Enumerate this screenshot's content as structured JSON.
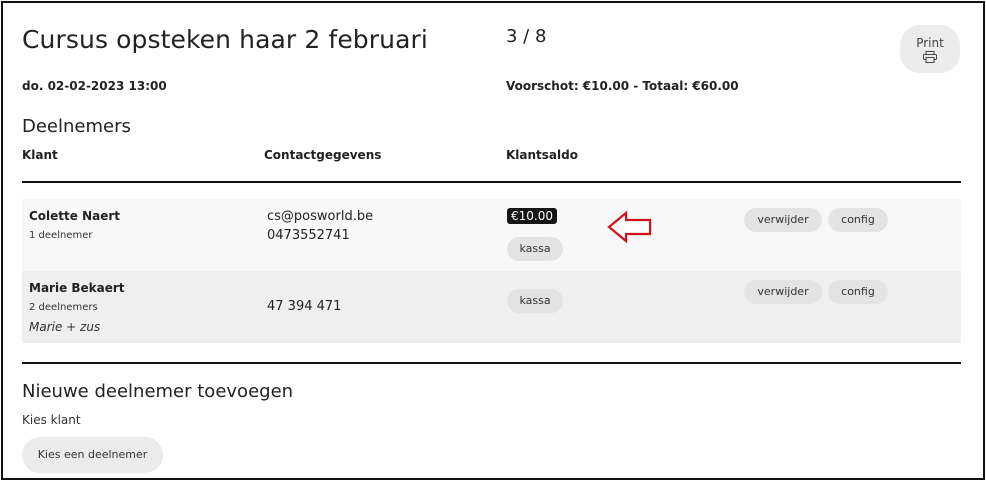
{
  "header": {
    "title": "Cursus opsteken haar 2 februari",
    "capacity": "3 / 8",
    "date": "do. 02-02-2023 13:00",
    "money": "Voorschot: €10.00 - Totaal: €60.00",
    "print_label": "Print",
    "print_icon": "printer-icon"
  },
  "participants": {
    "section_title": "Deelnemers",
    "columns": [
      "Klant",
      "Contactgegevens",
      "Klantsaldo"
    ],
    "rows": [
      {
        "name": "Colette Naert",
        "count": "1 deelnemer",
        "note": "",
        "email": "cs@posworld.be",
        "phone": "0473552741",
        "balance": "€10.00",
        "kassa": "kassa",
        "remove": "verwijder",
        "config": "config"
      },
      {
        "name": "Marie Bekaert",
        "count": "2 deelnemers",
        "note": "Marie + zus",
        "email": "",
        "phone": "47 394 471",
        "balance": "",
        "kassa": "kassa",
        "remove": "verwijder",
        "config": "config"
      }
    ]
  },
  "annotation": {
    "icon": "red-arrow-left-icon",
    "color": "#d0121b"
  },
  "add_participant": {
    "title": "Nieuwe deelnemer toevoegen",
    "label": "Kies klant",
    "button": "Kies een deelnemer"
  }
}
